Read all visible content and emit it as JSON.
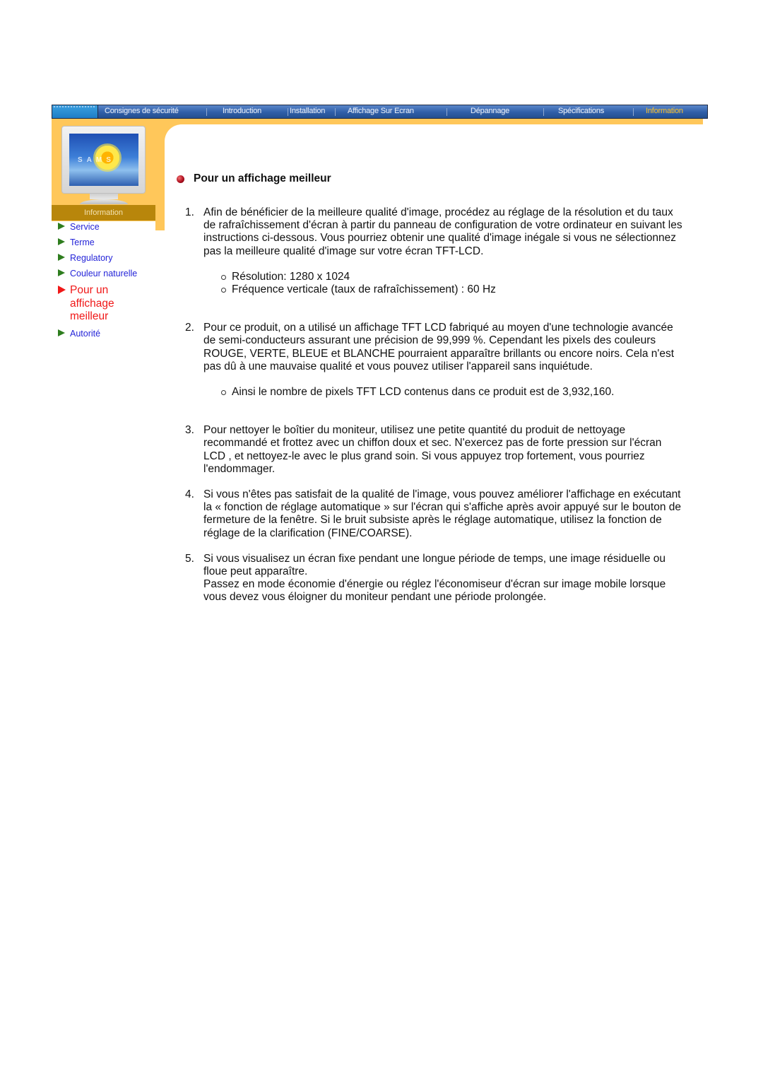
{
  "nav": {
    "items": [
      {
        "label": "Consignes de sécurité",
        "active": false
      },
      {
        "label": "Introduction",
        "active": false
      },
      {
        "label": "Installation",
        "active": false
      },
      {
        "label": "Affichage Sur Ecran",
        "active": false
      },
      {
        "label": "Dépannage",
        "active": false
      },
      {
        "label": "Spécifications",
        "active": false
      },
      {
        "label": "Information",
        "active": true
      }
    ]
  },
  "hero": {
    "monitor_brand": "SAMS",
    "section_label": "Information"
  },
  "sidebar": {
    "items": [
      {
        "label": "Service",
        "active": false
      },
      {
        "label": "Terme",
        "active": false
      },
      {
        "label": "Regulatory",
        "active": false
      },
      {
        "label": "Couleur naturelle",
        "active": false
      },
      {
        "label": "Pour un affichage meilleur",
        "active": true
      },
      {
        "label": "Autorité",
        "active": false
      }
    ]
  },
  "main": {
    "title": "Pour un affichage meilleur",
    "steps": [
      {
        "num": "1.",
        "text": "Afin de bénéficier de la meilleure qualité d'image, procédez au réglage de la résolution et du taux de rafraîchissement d'écran à partir du panneau de configuration de votre ordinateur en suivant les instructions ci-dessous. Vous pourriez obtenir une qualité d'image inégale si vous ne sélectionnez pas la meilleure qualité d'image sur votre écran TFT-LCD.",
        "subs": [
          "Résolution: 1280 x 1024",
          "Fréquence verticale (taux de rafraîchissement) : 60 Hz"
        ]
      },
      {
        "num": "2.",
        "text": "Pour ce produit, on a utilisé un affichage TFT LCD fabriqué au moyen d'une technologie avancée de semi-conducteurs assurant une précision de 99,999 %. Cependant les pixels des couleurs ROUGE, VERTE, BLEUE et BLANCHE pourraient apparaître brillants ou encore noirs. Cela n'est pas dû à une mauvaise qualité et vous pouvez utiliser l'appareil sans inquiétude.",
        "subs": [
          "Ainsi le nombre de pixels TFT LCD contenus dans ce produit est de 3,932,160."
        ]
      },
      {
        "num": "3.",
        "text": "Pour nettoyer le boîtier du moniteur, utilisez une petite quantité du produit de nettoyage recommandé et frottez avec un chiffon doux et sec. N'exercez pas de forte pression sur l'écran LCD , et nettoyez-le avec le plus grand soin. Si vous appuyez trop fortement, vous pourriez l'endommager."
      },
      {
        "num": "4.",
        "text": "Si vous n'êtes pas satisfait de la qualité de l'image, vous pouvez améliorer l'affichage en exécutant la « fonction de réglage automatique » sur l'écran qui s'affiche après avoir appuyé sur le bouton de fermeture de la fenêtre. Si le bruit subsiste après le réglage automatique, utilisez la fonction de réglage de la clarification (FINE/COARSE)."
      },
      {
        "num": "5.",
        "text": "Si vous visualisez un écran fixe pendant une longue période de temps, une image résiduelle ou floue peut apparaître.",
        "text2": "Passez en mode économie d'énergie ou réglez l'économiseur d'écran sur image mobile lorsque vous devez vous éloigner du moniteur pendant une période prolongée."
      }
    ]
  },
  "colors": {
    "nav_blue": "#2f5ea8",
    "orange": "#ffc75a",
    "gold": "#b8860b",
    "link_blue": "#2424d8",
    "active_red": "#f01818",
    "arrow_green": "#2e7d1e"
  }
}
